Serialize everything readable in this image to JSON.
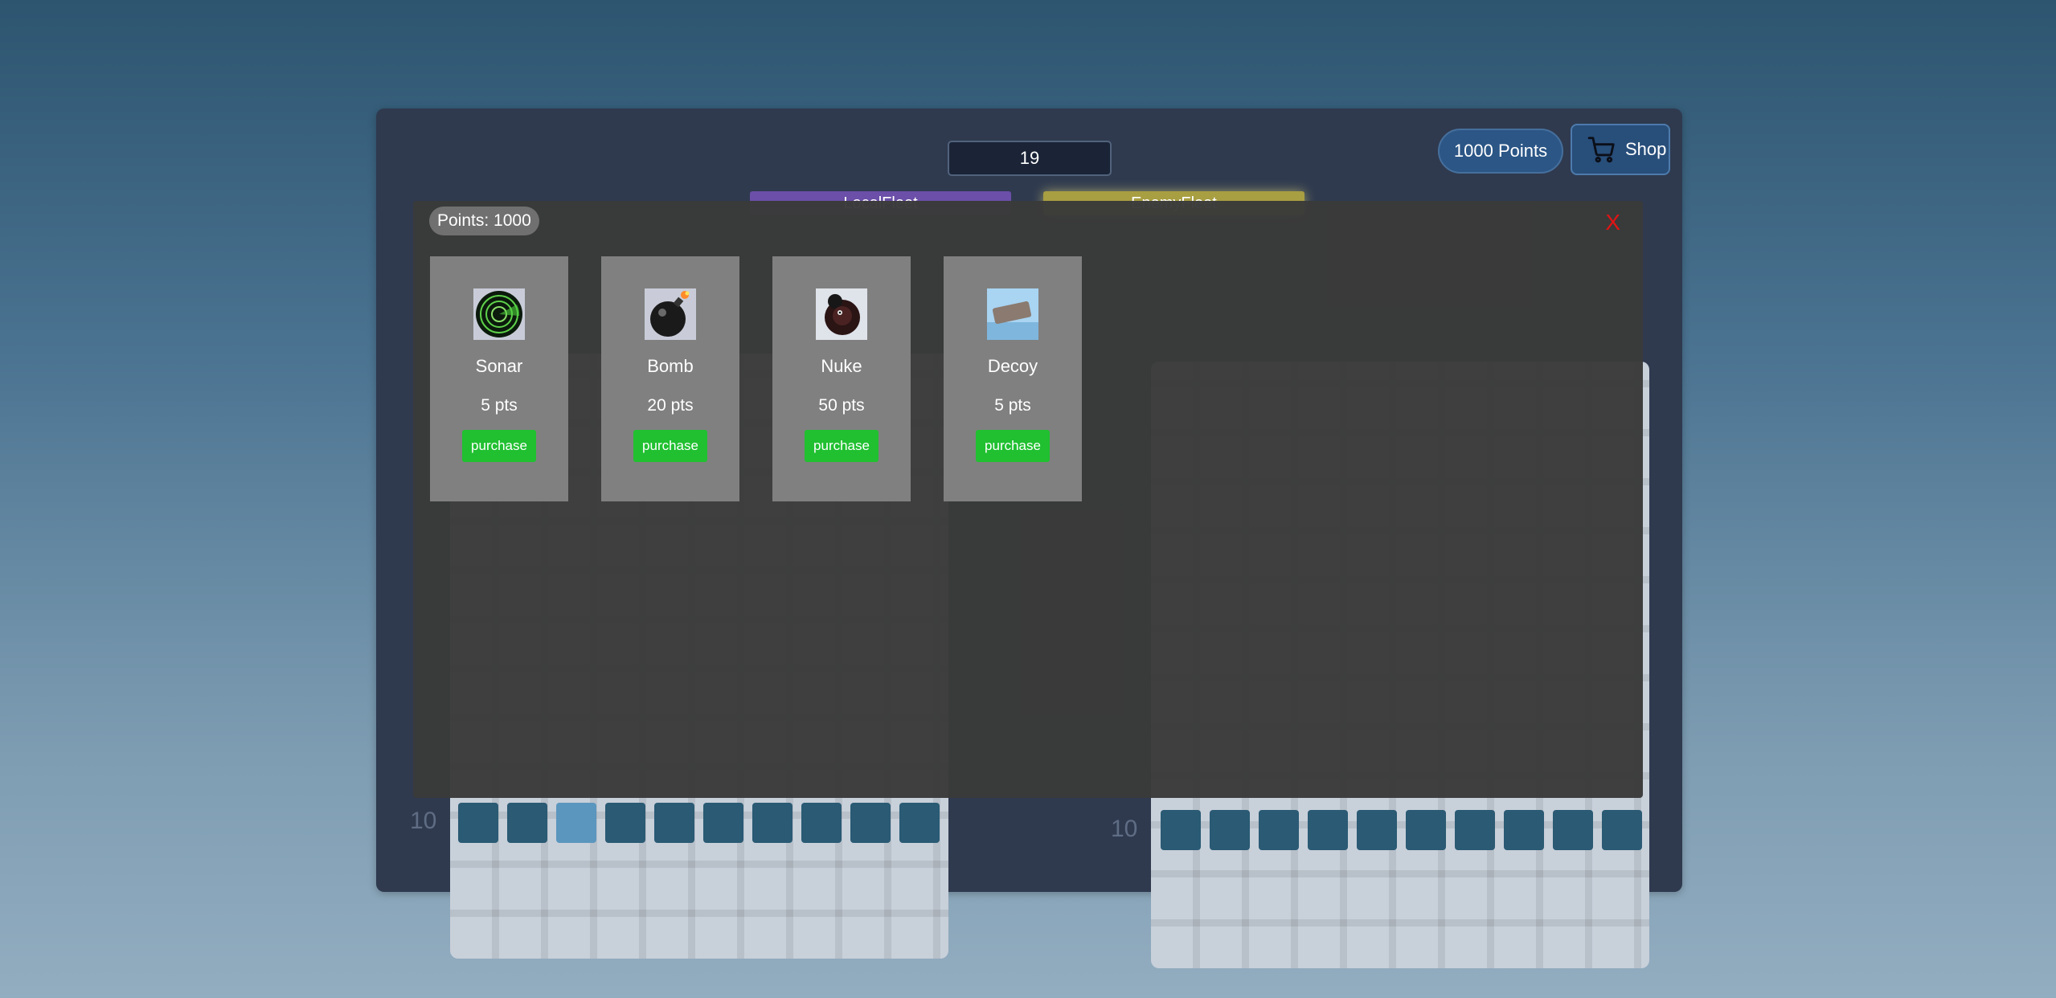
{
  "header": {
    "turn_value": "19",
    "points_label": "1000 Points",
    "shop_label": "Shop",
    "tabs": [
      "LocalFleet",
      "EnemyFleet"
    ]
  },
  "board_left": {
    "row_label": "10"
  },
  "board_right": {
    "row_label": "10"
  },
  "shop": {
    "points_label": "Points: 1000",
    "close_label": "X",
    "items": [
      {
        "name": "Sonar",
        "price": "5 pts",
        "button": "purchase",
        "icon": "sonar-icon"
      },
      {
        "name": "Bomb",
        "price": "20 pts",
        "button": "purchase",
        "icon": "bomb-icon"
      },
      {
        "name": "Nuke",
        "price": "50 pts",
        "button": "purchase",
        "icon": "nuke-icon"
      },
      {
        "name": "Decoy",
        "price": "5 pts",
        "button": "purchase",
        "icon": "decoy-icon"
      }
    ]
  },
  "colors": {
    "accent_green": "#20c030",
    "close_red": "#e01414",
    "cell_blue": "#2a5a74",
    "cell_highlight": "#5b96be"
  }
}
